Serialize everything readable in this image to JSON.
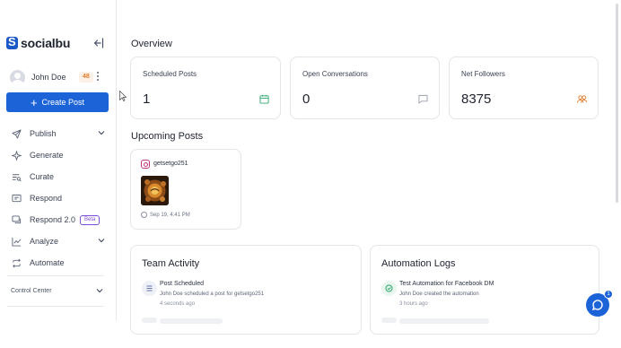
{
  "brand": {
    "name": "socialbu"
  },
  "user": {
    "name": "John Doe",
    "badge": "48"
  },
  "create_button": {
    "label": "Create Post"
  },
  "nav": [
    {
      "label": "Publish",
      "icon": "send-icon",
      "has_chevron": true
    },
    {
      "label": "Generate",
      "icon": "sparkle-icon",
      "has_chevron": false
    },
    {
      "label": "Curate",
      "icon": "curate-icon",
      "has_chevron": false
    },
    {
      "label": "Respond",
      "icon": "message-icon",
      "has_chevron": false
    },
    {
      "label": "Respond 2.0",
      "icon": "messages-icon",
      "has_chevron": false,
      "badge": "Beta"
    },
    {
      "label": "Analyze",
      "icon": "chart-icon",
      "has_chevron": true
    },
    {
      "label": "Automate",
      "icon": "repeat-icon",
      "has_chevron": false
    }
  ],
  "control_center": {
    "label": "Control Center"
  },
  "overview": {
    "title": "Overview",
    "cards": [
      {
        "label": "Scheduled Posts",
        "value": "1",
        "icon": "calendar-icon",
        "icon_color": "#2ea56a"
      },
      {
        "label": "Open Conversations",
        "value": "0",
        "icon": "chat-bubble-icon",
        "icon_color": "#9aa0ad"
      },
      {
        "label": "Net Followers",
        "value": "8375",
        "icon": "users-icon",
        "icon_color": "#e07b2a"
      }
    ]
  },
  "upcoming": {
    "title": "Upcoming Posts",
    "post": {
      "account": "getsetgo251",
      "network_icon": "instagram-icon",
      "time": "Sep 19, 4:41 PM"
    }
  },
  "team_activity": {
    "title": "Team Activity",
    "entry": {
      "title": "Post Scheduled",
      "desc": "John Doe scheduled a post for getsetgo251",
      "time": "4 seconds ago"
    }
  },
  "automation_logs": {
    "title": "Automation Logs",
    "entry": {
      "title": "Test Automation for Facebook DM",
      "desc": "John Doe created the automation",
      "time": "3 hours ago"
    }
  },
  "chat": {
    "count": "1"
  },
  "colors": {
    "accent": "#1d63d8",
    "badge_orange": "#e07b2a",
    "beta_purple": "#7c4ddb"
  }
}
